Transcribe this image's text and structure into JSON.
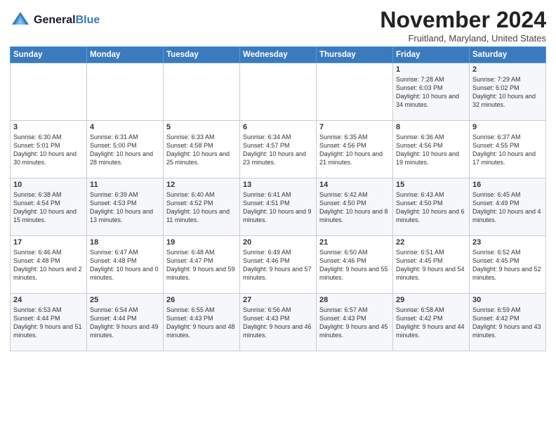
{
  "header": {
    "logo_line1": "General",
    "logo_line2": "Blue",
    "month": "November 2024",
    "location": "Fruitland, Maryland, United States"
  },
  "weekdays": [
    "Sunday",
    "Monday",
    "Tuesday",
    "Wednesday",
    "Thursday",
    "Friday",
    "Saturday"
  ],
  "weeks": [
    [
      {
        "day": "",
        "info": ""
      },
      {
        "day": "",
        "info": ""
      },
      {
        "day": "",
        "info": ""
      },
      {
        "day": "",
        "info": ""
      },
      {
        "day": "",
        "info": ""
      },
      {
        "day": "1",
        "info": "Sunrise: 7:28 AM\nSunset: 6:03 PM\nDaylight: 10 hours and 34 minutes."
      },
      {
        "day": "2",
        "info": "Sunrise: 7:29 AM\nSunset: 6:02 PM\nDaylight: 10 hours and 32 minutes."
      }
    ],
    [
      {
        "day": "3",
        "info": "Sunrise: 6:30 AM\nSunset: 5:01 PM\nDaylight: 10 hours and 30 minutes."
      },
      {
        "day": "4",
        "info": "Sunrise: 6:31 AM\nSunset: 5:00 PM\nDaylight: 10 hours and 28 minutes."
      },
      {
        "day": "5",
        "info": "Sunrise: 6:33 AM\nSunset: 4:58 PM\nDaylight: 10 hours and 25 minutes."
      },
      {
        "day": "6",
        "info": "Sunrise: 6:34 AM\nSunset: 4:57 PM\nDaylight: 10 hours and 23 minutes."
      },
      {
        "day": "7",
        "info": "Sunrise: 6:35 AM\nSunset: 4:56 PM\nDaylight: 10 hours and 21 minutes."
      },
      {
        "day": "8",
        "info": "Sunrise: 6:36 AM\nSunset: 4:56 PM\nDaylight: 10 hours and 19 minutes."
      },
      {
        "day": "9",
        "info": "Sunrise: 6:37 AM\nSunset: 4:55 PM\nDaylight: 10 hours and 17 minutes."
      }
    ],
    [
      {
        "day": "10",
        "info": "Sunrise: 6:38 AM\nSunset: 4:54 PM\nDaylight: 10 hours and 15 minutes."
      },
      {
        "day": "11",
        "info": "Sunrise: 6:39 AM\nSunset: 4:53 PM\nDaylight: 10 hours and 13 minutes."
      },
      {
        "day": "12",
        "info": "Sunrise: 6:40 AM\nSunset: 4:52 PM\nDaylight: 10 hours and 11 minutes."
      },
      {
        "day": "13",
        "info": "Sunrise: 6:41 AM\nSunset: 4:51 PM\nDaylight: 10 hours and 9 minutes."
      },
      {
        "day": "14",
        "info": "Sunrise: 6:42 AM\nSunset: 4:50 PM\nDaylight: 10 hours and 8 minutes."
      },
      {
        "day": "15",
        "info": "Sunrise: 6:43 AM\nSunset: 4:50 PM\nDaylight: 10 hours and 6 minutes."
      },
      {
        "day": "16",
        "info": "Sunrise: 6:45 AM\nSunset: 4:49 PM\nDaylight: 10 hours and 4 minutes."
      }
    ],
    [
      {
        "day": "17",
        "info": "Sunrise: 6:46 AM\nSunset: 4:48 PM\nDaylight: 10 hours and 2 minutes."
      },
      {
        "day": "18",
        "info": "Sunrise: 6:47 AM\nSunset: 4:48 PM\nDaylight: 10 hours and 0 minutes."
      },
      {
        "day": "19",
        "info": "Sunrise: 6:48 AM\nSunset: 4:47 PM\nDaylight: 9 hours and 59 minutes."
      },
      {
        "day": "20",
        "info": "Sunrise: 6:49 AM\nSunset: 4:46 PM\nDaylight: 9 hours and 57 minutes."
      },
      {
        "day": "21",
        "info": "Sunrise: 6:50 AM\nSunset: 4:46 PM\nDaylight: 9 hours and 55 minutes."
      },
      {
        "day": "22",
        "info": "Sunrise: 6:51 AM\nSunset: 4:45 PM\nDaylight: 9 hours and 54 minutes."
      },
      {
        "day": "23",
        "info": "Sunrise: 6:52 AM\nSunset: 4:45 PM\nDaylight: 9 hours and 52 minutes."
      }
    ],
    [
      {
        "day": "24",
        "info": "Sunrise: 6:53 AM\nSunset: 4:44 PM\nDaylight: 9 hours and 51 minutes."
      },
      {
        "day": "25",
        "info": "Sunrise: 6:54 AM\nSunset: 4:44 PM\nDaylight: 9 hours and 49 minutes."
      },
      {
        "day": "26",
        "info": "Sunrise: 6:55 AM\nSunset: 4:43 PM\nDaylight: 9 hours and 48 minutes."
      },
      {
        "day": "27",
        "info": "Sunrise: 6:56 AM\nSunset: 4:43 PM\nDaylight: 9 hours and 46 minutes."
      },
      {
        "day": "28",
        "info": "Sunrise: 6:57 AM\nSunset: 4:43 PM\nDaylight: 9 hours and 45 minutes."
      },
      {
        "day": "29",
        "info": "Sunrise: 6:58 AM\nSunset: 4:42 PM\nDaylight: 9 hours and 44 minutes."
      },
      {
        "day": "30",
        "info": "Sunrise: 6:59 AM\nSunset: 4:42 PM\nDaylight: 9 hours and 43 minutes."
      }
    ]
  ]
}
